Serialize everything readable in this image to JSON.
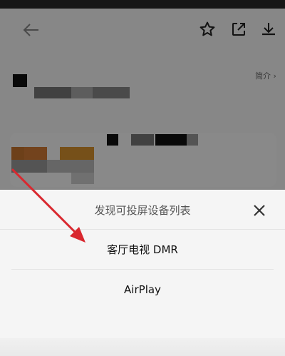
{
  "app": {
    "intro_link": "简介 ›"
  },
  "sheet": {
    "title": "发现可投屏设备列表",
    "devices": [
      {
        "label": "客厅电视 DMR"
      },
      {
        "label": "AirPlay"
      }
    ]
  },
  "icons": {
    "back": "back-arrow-icon",
    "star": "star-icon",
    "share": "share-icon",
    "download": "download-icon",
    "close": "close-icon"
  },
  "colors": {
    "annotation": "#d9282f",
    "scrim": "rgba(0,0,0,0.45)",
    "sheet_bg": "#f5f5f5"
  }
}
